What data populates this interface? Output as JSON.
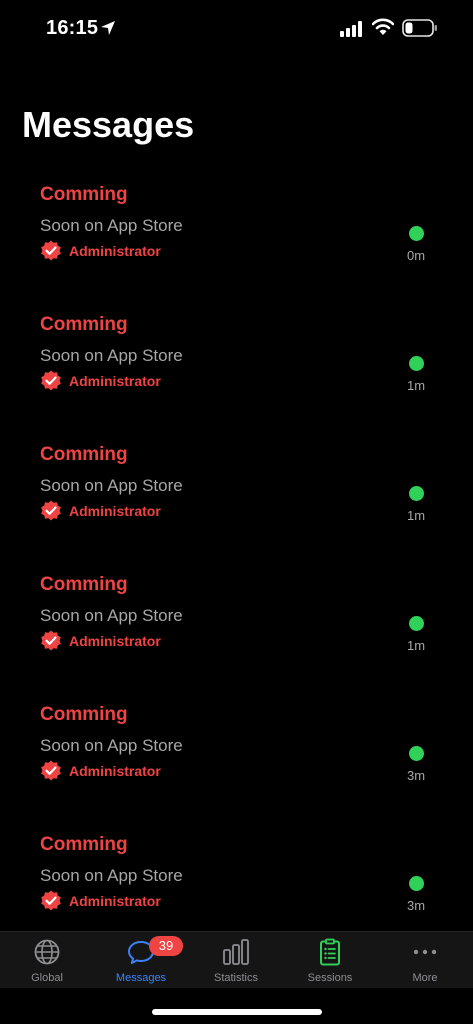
{
  "status_bar": {
    "time": "16:15"
  },
  "header": {
    "title": "Messages"
  },
  "messages": [
    {
      "title": "Comming",
      "body": "Soon on App Store",
      "author": "Administrator",
      "time": "0m"
    },
    {
      "title": "Comming",
      "body": "Soon on App Store",
      "author": "Administrator",
      "time": "1m"
    },
    {
      "title": "Comming",
      "body": "Soon on App Store",
      "author": "Administrator",
      "time": "1m"
    },
    {
      "title": "Comming",
      "body": "Soon on App Store",
      "author": "Administrator",
      "time": "1m"
    },
    {
      "title": "Comming",
      "body": "Soon on App Store",
      "author": "Administrator",
      "time": "3m"
    },
    {
      "title": "Comming",
      "body": "Soon on App Store",
      "author": "Administrator",
      "time": "3m"
    }
  ],
  "tab_bar": {
    "tabs": [
      {
        "label": "Global",
        "icon": "globe-icon",
        "active": false
      },
      {
        "label": "Messages",
        "icon": "chat-bubble-icon",
        "active": true,
        "badge": "39"
      },
      {
        "label": "Statistics",
        "icon": "bar-chart-icon",
        "active": false
      },
      {
        "label": "Sessions",
        "icon": "clipboard-list-icon",
        "active": false
      },
      {
        "label": "More",
        "icon": "ellipsis-icon",
        "active": false
      }
    ]
  },
  "colors": {
    "accent_red": "#ef4444",
    "active_blue": "#3b82f6",
    "online_green": "#30d158",
    "sessions_green": "#30d158"
  }
}
